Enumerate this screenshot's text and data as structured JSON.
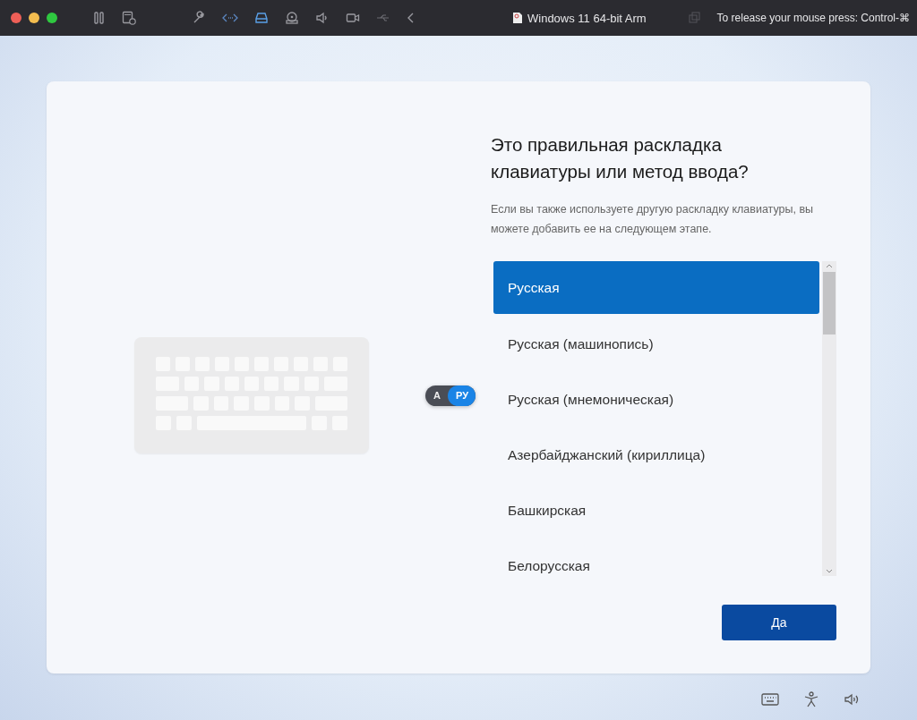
{
  "window": {
    "title": "Windows 11 64-bit Arm",
    "hint": "To release your mouse press: Control-⌘"
  },
  "setup": {
    "heading": "Это правильная раскладка клавиатуры или метод ввода?",
    "description": "Если вы также используете другую раскладку клавиатуры, вы можете добавить ее на следующем этапе.",
    "layout_switch": [
      {
        "label": "А",
        "selected": false
      },
      {
        "label": "РУ",
        "selected": true
      }
    ],
    "layouts": [
      {
        "label": "Русская",
        "selected": true
      },
      {
        "label": "Русская (машинопись)",
        "selected": false
      },
      {
        "label": "Русская (мнемоническая)",
        "selected": false
      },
      {
        "label": "Азербайджанский (кириллица)",
        "selected": false
      },
      {
        "label": "Башкирская",
        "selected": false
      },
      {
        "label": "Белорусская",
        "selected": false
      }
    ],
    "button": "Да"
  }
}
